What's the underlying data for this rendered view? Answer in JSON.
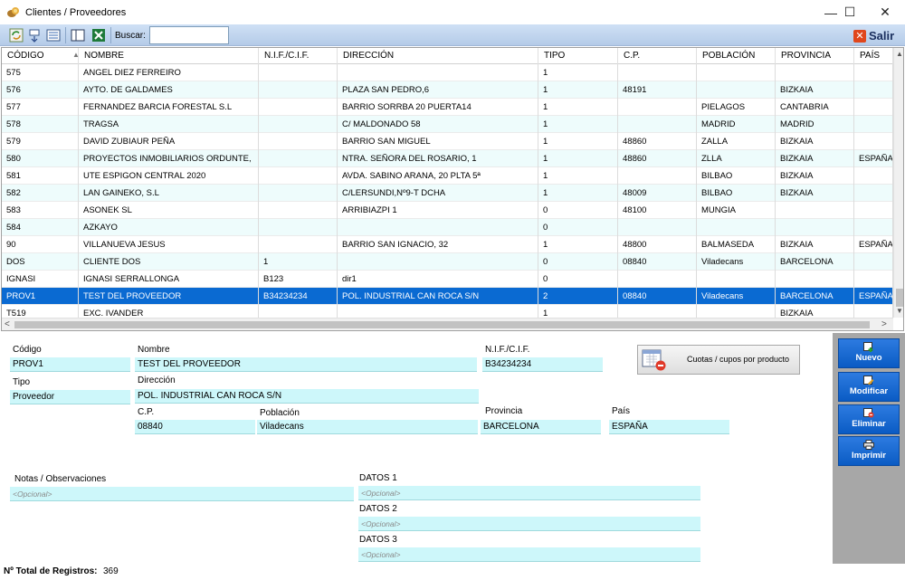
{
  "window": {
    "title": "Clientes / Proveedores",
    "controls": {
      "minimize": "—",
      "maximize": "☐",
      "close": "✕"
    }
  },
  "toolbar": {
    "search_label": "Buscar:",
    "search_value": "",
    "exit_label": "Salir",
    "exit_icon": "✕",
    "icons": [
      "refresh-icon",
      "expand-icon",
      "list-icon",
      "panel-icon",
      "excel-icon"
    ]
  },
  "grid": {
    "columns": [
      "CÓDIGO",
      "NOMBRE",
      "N.I.F./C.I.F.",
      "DIRECCIÓN",
      "TIPO",
      "C.P.",
      "POBLACIÓN",
      "PROVINCIA",
      "PAÍS"
    ],
    "sort_indicator": "▲",
    "rows": [
      [
        "575",
        "ANGEL DIEZ FERREIRO",
        "",
        "",
        "1",
        "",
        "",
        "",
        ""
      ],
      [
        "576",
        "AYTO. DE GALDAMES",
        "",
        "PLAZA SAN PEDRO,6",
        "1",
        "48191",
        "",
        "BIZKAIA",
        ""
      ],
      [
        "577",
        "FERNANDEZ BARCIA FORESTAL S.L",
        "",
        "BARRIO SORRBA 20 PUERTA14",
        "1",
        "",
        "PIELAGOS",
        "CANTABRIA",
        ""
      ],
      [
        "578",
        "TRAGSA",
        "",
        "C/ MALDONADO 58",
        "1",
        "",
        "MADRID",
        "MADRID",
        ""
      ],
      [
        "579",
        "DAVID ZUBIAUR PEÑA",
        "",
        "BARRIO SAN MIGUEL",
        "1",
        "48860",
        "ZALLA",
        "BIZKAIA",
        ""
      ],
      [
        "580",
        "PROYECTOS INMOBILIARIOS ORDUNTE,",
        "",
        "NTRA. SEÑORA DEL ROSARIO, 1",
        "1",
        "48860",
        "ZLLA",
        "BIZKAIA",
        "ESPAÑA"
      ],
      [
        "581",
        "UTE ESPIGON CENTRAL 2020",
        "",
        "AVDA. SABINO ARANA, 20 PLTA 5ª",
        "1",
        "",
        "BILBAO",
        "BIZKAIA",
        ""
      ],
      [
        "582",
        "LAN GAINEKO, S.L",
        "",
        "C/LERSUNDI,Nº9-T DCHA",
        "1",
        "48009",
        "BILBAO",
        "BIZKAIA",
        ""
      ],
      [
        "583",
        "ASONEK SL",
        "",
        "ARRIBIAZPI 1",
        "0",
        "48100",
        "MUNGIA",
        "",
        ""
      ],
      [
        "584",
        "AZKAYO",
        "",
        "",
        "0",
        "",
        "",
        "",
        ""
      ],
      [
        "90",
        "VILLANUEVA JESUS",
        "",
        "BARRIO SAN IGNACIO, 32",
        "1",
        "48800",
        "BALMASEDA",
        "BIZKAIA",
        "ESPAÑA"
      ],
      [
        "DOS",
        "CLIENTE DOS",
        "1",
        "",
        "0",
        "08840",
        "Viladecans",
        "BARCELONA",
        ""
      ],
      [
        "IGNASI",
        "IGNASI SERRALLONGA",
        "B123",
        "dir1",
        "0",
        "",
        "",
        "",
        ""
      ],
      [
        "PROV1",
        "TEST DEL PROVEEDOR",
        "B34234234",
        "POL. INDUSTRIAL CAN ROCA S/N",
        "2",
        "08840",
        "Viladecans",
        "BARCELONA",
        "ESPAÑA"
      ],
      [
        "T519",
        "EXC. IVANDER",
        "",
        "",
        "1",
        "",
        "",
        "BIZKAIA",
        ""
      ]
    ],
    "selected_row": 13,
    "scroll": {
      "left": "<",
      "right": ">",
      "up": "▲",
      "down": "▼"
    }
  },
  "detail": {
    "codigo_label": "Código",
    "codigo": "PROV1",
    "nombre_label": "Nombre",
    "nombre": "TEST DEL PROVEEDOR",
    "nif_label": "N.I.F./C.I.F.",
    "nif": "B34234234",
    "tipo_label": "Tipo",
    "tipo": "Proveedor",
    "direccion_label": "Dirección",
    "direccion": "POL. INDUSTRIAL CAN ROCA S/N",
    "cp_label": "C.P.",
    "cp": "08840",
    "poblacion_label": "Población",
    "poblacion": "Viladecans",
    "provincia_label": "Provincia",
    "provincia": "BARCELONA",
    "pais_label": "País",
    "pais": "ESPAÑA",
    "notas_label": "Notas / Observaciones",
    "notas_placeholder": "<Opcional>",
    "datos1_label": "DATOS 1",
    "datos1_placeholder": "<Opcional>",
    "datos2_label": "DATOS 2",
    "datos2_placeholder": "<Opcional>",
    "datos3_label": "DATOS 3",
    "datos3_placeholder": "<Opcional>",
    "cuotas_label": "Cuotas / cupos por producto"
  },
  "actions": {
    "nuevo": "Nuevo",
    "modificar": "Modificar",
    "eliminar": "Eliminar",
    "imprimir": "Imprimir"
  },
  "status": {
    "total_label": "Nº Total de Registros:",
    "total_value": "369"
  },
  "colors": {
    "selection": "#0a6ad2",
    "alt_row": "#eefcfc",
    "field_bg": "#cdf7fa",
    "action_btn": "#1a6ed6",
    "toolbar": "#c4d8f0"
  }
}
